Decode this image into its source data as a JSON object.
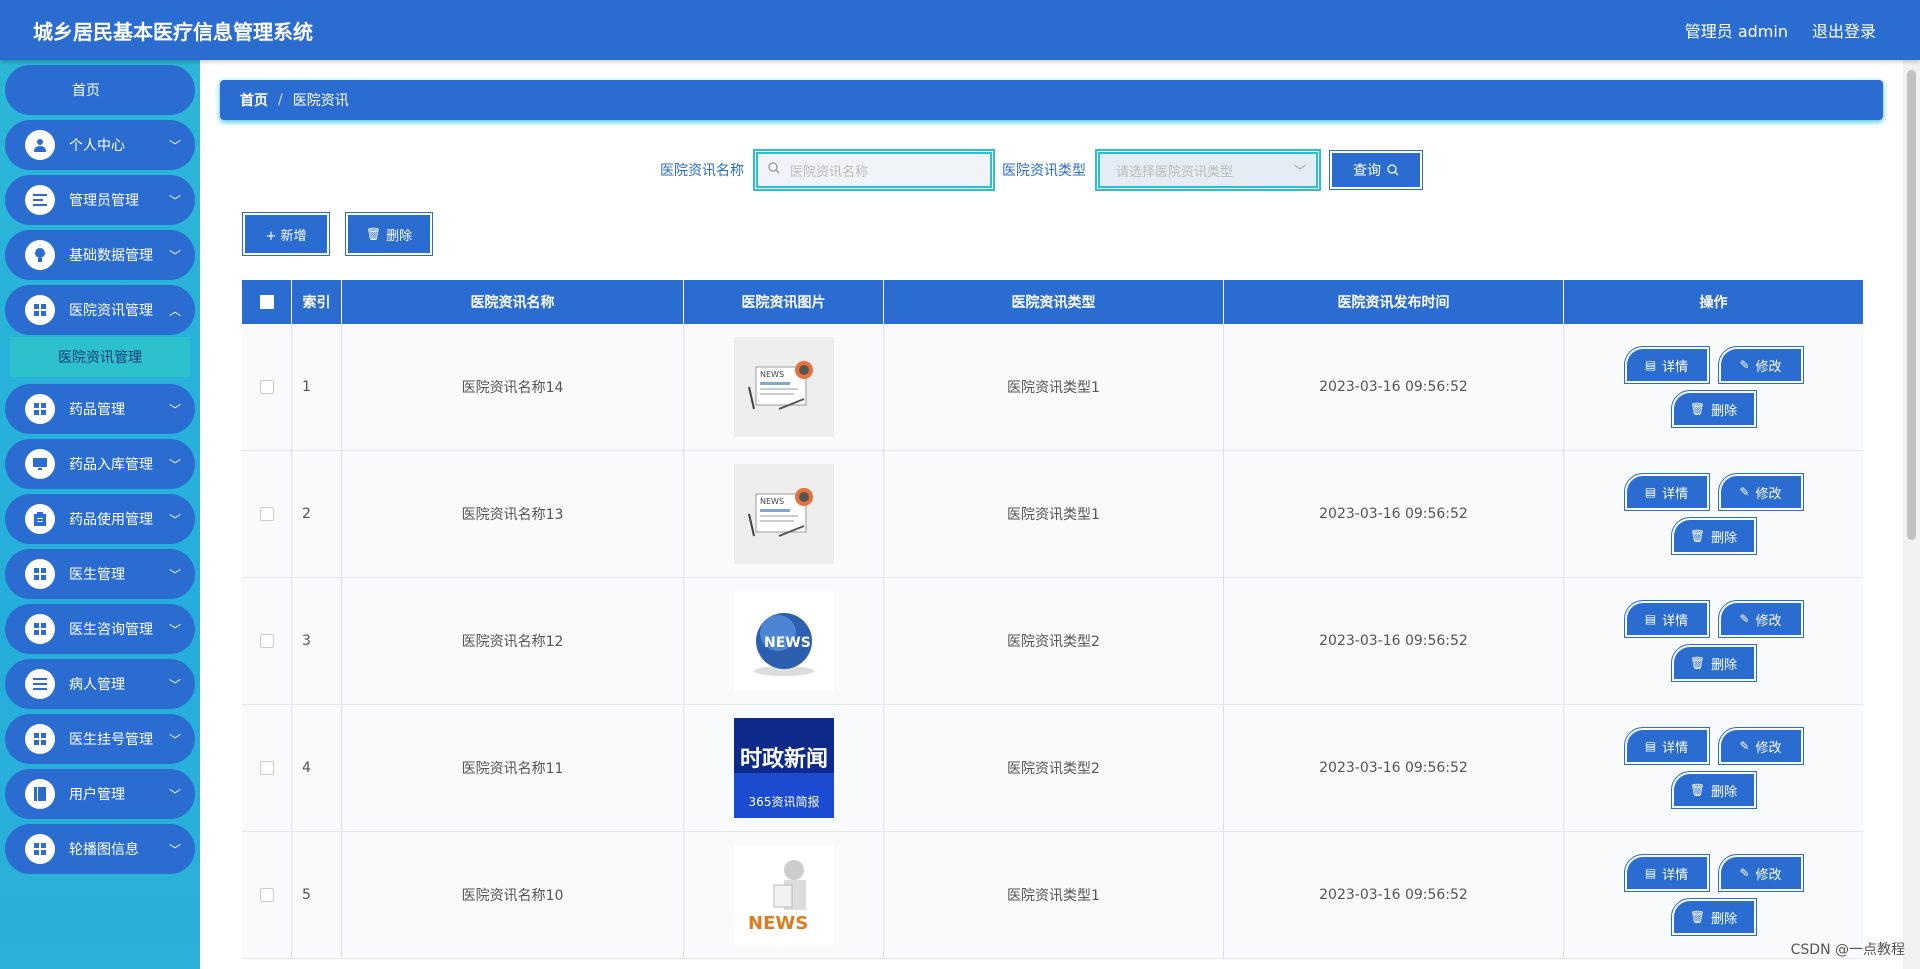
{
  "header": {
    "title": "城乡居民基本医疗信息管理系统",
    "user": "管理员 admin",
    "logout": "退出登录"
  },
  "sidebar": {
    "home": "首页",
    "items": [
      {
        "label": "个人中心",
        "icon": "user-icon"
      },
      {
        "label": "管理员管理",
        "icon": "list-icon"
      },
      {
        "label": "基础数据管理",
        "icon": "bulb-icon"
      },
      {
        "label": "医院资讯管理",
        "icon": "grid-icon"
      },
      {
        "label": "药品管理",
        "icon": "grid-icon"
      },
      {
        "label": "药品入库管理",
        "icon": "monitor-icon"
      },
      {
        "label": "药品使用管理",
        "icon": "clipboard-icon"
      },
      {
        "label": "医生管理",
        "icon": "grid-icon"
      },
      {
        "label": "医生咨询管理",
        "icon": "grid-icon"
      },
      {
        "label": "病人管理",
        "icon": "list-icon"
      },
      {
        "label": "医生挂号管理",
        "icon": "grid-icon"
      },
      {
        "label": "用户管理",
        "icon": "book-icon"
      },
      {
        "label": "轮播图信息",
        "icon": "grid-icon"
      }
    ],
    "submenu": "医院资讯管理"
  },
  "breadcrumb": {
    "home": "首页",
    "sep": "/",
    "current": "医院资讯"
  },
  "search": {
    "name_label": "医院资讯名称",
    "name_placeholder": "医院资讯名称",
    "type_label": "医院资讯类型",
    "type_placeholder": "请选择医院资讯类型",
    "query": "查询"
  },
  "actions": {
    "add": "+ 新增",
    "delete": "删除"
  },
  "table": {
    "headers": [
      "索引",
      "医院资讯名称",
      "医院资讯图片",
      "医院资讯类型",
      "医院资讯发布时间",
      "操作"
    ],
    "rows": [
      {
        "index": "1",
        "name": "医院资讯名称14",
        "image": "news-paper",
        "type": "医院资讯类型1",
        "time": "2023-03-16 09:56:52"
      },
      {
        "index": "2",
        "name": "医院资讯名称13",
        "image": "news-paper",
        "type": "医院资讯类型1",
        "time": "2023-03-16 09:56:52"
      },
      {
        "index": "3",
        "name": "医院资讯名称12",
        "image": "news-globe",
        "type": "医院资讯类型2",
        "time": "2023-03-16 09:56:52"
      },
      {
        "index": "4",
        "name": "医院资讯名称11",
        "image": "news-politics",
        "type": "医院资讯类型2",
        "time": "2023-03-16 09:56:52"
      },
      {
        "index": "5",
        "name": "医院资讯名称10",
        "image": "news-figure",
        "type": "医院资讯类型1",
        "time": "2023-03-16 09:56:52"
      }
    ],
    "ops": {
      "detail": "详情",
      "edit": "修改",
      "delete": "删除"
    },
    "thumb_text": {
      "paper": "NEWS",
      "globe": "NEWS",
      "politics_title": "时政新闻",
      "politics_sub": "365资讯简报",
      "figure": "NEWS"
    }
  },
  "colors": {
    "primary": "#2a6cd0",
    "sidebar": "#2cb6d6",
    "accent": "#2bc0cc"
  },
  "watermark": "CSDN @一点教程"
}
